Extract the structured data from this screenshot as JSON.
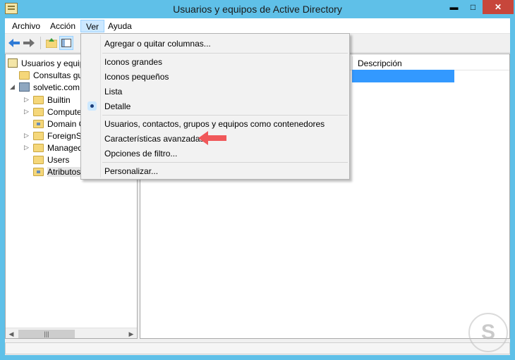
{
  "window": {
    "title": "Usuarios y equipos de Active Directory",
    "minimize_glyph": "▬",
    "maximize_glyph": "□",
    "close_glyph": "✕",
    "accent_color": "#5fc0e8"
  },
  "menubar": {
    "items": [
      {
        "label": "Archivo"
      },
      {
        "label": "Acción"
      },
      {
        "label": "Ver",
        "active": true
      },
      {
        "label": "Ayuda"
      }
    ]
  },
  "toolbar": {
    "icons": [
      "back-arrow-icon",
      "forward-arrow-icon",
      "up-folder-icon",
      "show-hide-tree-icon"
    ]
  },
  "tree": {
    "items": [
      {
        "label": "Usuarios y equip",
        "icon": "root-icon"
      },
      {
        "label": "Consultas gu",
        "icon": "folder-icon"
      },
      {
        "label": "solvetic.com",
        "icon": "domain-icon",
        "expanded": true
      },
      {
        "label": "Builtin",
        "icon": "folder-icon"
      },
      {
        "label": "Compute",
        "icon": "folder-icon"
      },
      {
        "label": "Domain C",
        "icon": "ou-icon"
      },
      {
        "label": "ForeignSe",
        "icon": "folder-icon"
      },
      {
        "label": "Managed",
        "icon": "folder-icon"
      },
      {
        "label": "Users",
        "icon": "folder-icon"
      },
      {
        "label": "Atributos",
        "icon": "ou-icon",
        "selected": true
      }
    ]
  },
  "list": {
    "columns": [
      {
        "label": "Descripción"
      }
    ]
  },
  "view_menu": {
    "items": [
      {
        "label": "Agregar o quitar columnas..."
      },
      {
        "label": "Iconos grandes"
      },
      {
        "label": "Iconos pequeños"
      },
      {
        "label": "Lista"
      },
      {
        "label": "Detalle",
        "checked": true
      },
      {
        "label": "Usuarios, contactos, grupos y equipos como contenedores"
      },
      {
        "label": "Características avanzadas",
        "highlighted_by_arrow": true
      },
      {
        "label": "Opciones de filtro..."
      },
      {
        "label": "Personalizar..."
      }
    ]
  },
  "watermark": {
    "glyph": "S"
  }
}
